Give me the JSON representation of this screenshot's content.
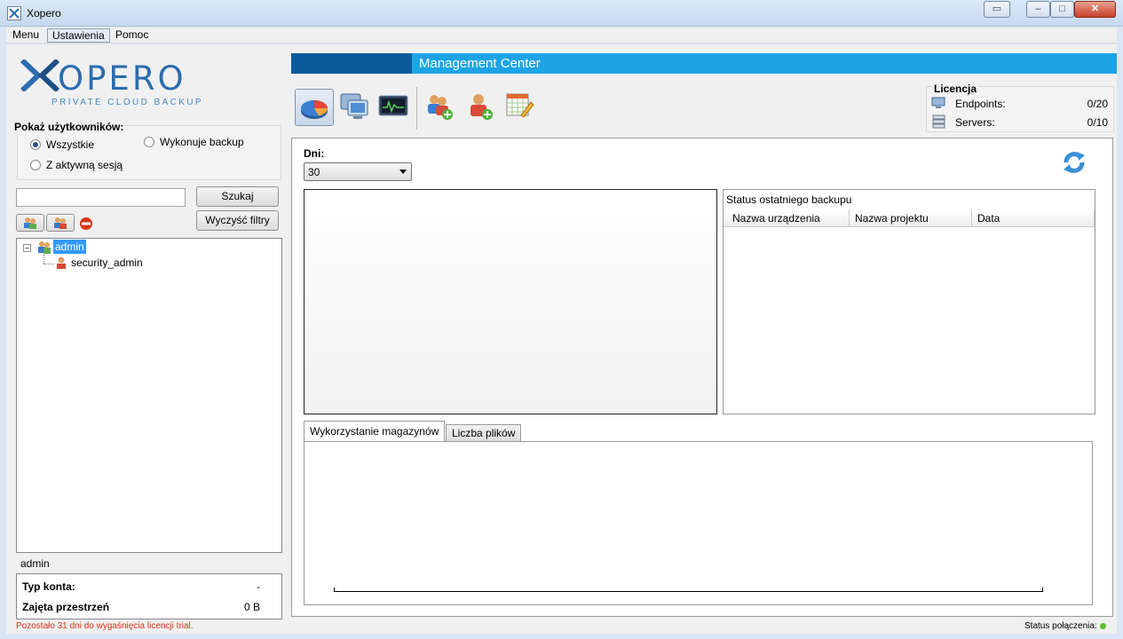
{
  "window": {
    "title": "Xopero"
  },
  "menu": {
    "items": [
      "Menu",
      "Ustawienia",
      "Pomoc"
    ],
    "active": "Ustawienia"
  },
  "logo": {
    "name": "XOPERO",
    "tagline": "PRIVATE CLOUD BACKUP"
  },
  "filters": {
    "title": "Pokaż użytkowników:",
    "options": {
      "all": "Wszystkie",
      "backing_up": "Wykonuje backup",
      "active_session": "Z aktywną sesją"
    },
    "selected": "Wszystkie"
  },
  "search": {
    "value": "",
    "button": "Szukaj",
    "clear_button": "Wyczyść filtry"
  },
  "tree": {
    "root": "admin",
    "child": "security_admin"
  },
  "selected_user": "admin",
  "account_info": {
    "type_label": "Typ konta:",
    "type_value": "-",
    "space_label": "Zajęta przestrzeń",
    "space_value": "0 B"
  },
  "status": {
    "trial": "Pozostało 31 dni do wygaśnięcia licencji trial.",
    "connection_label": "Status połączenia:",
    "connection_color": "#5dbb2b"
  },
  "header": {
    "title": "Management Center"
  },
  "toolbar": [
    "dashboard-chart-icon",
    "computers-icon",
    "monitor-icon",
    "add-group-icon",
    "add-user-icon",
    "schedule-icon"
  ],
  "license": {
    "title": "Licencja",
    "endpoints_label": "Endpoints:",
    "endpoints_value": "0/20",
    "servers_label": "Servers:",
    "servers_value": "0/10"
  },
  "dashboard": {
    "days_label": "Dni:",
    "days_value": "30",
    "status_title": "Status ostatniego backupu",
    "columns": [
      "Nazwa urządzenia",
      "Nazwa projektu",
      "Data"
    ],
    "tabs": [
      "Wykorzystanie magazynów",
      "Liczba plików"
    ],
    "active_tab": "Wykorzystanie magazynów"
  },
  "colors": {
    "brand": "#2b6dae",
    "header_bar": "#1da4e4",
    "header_dark": "#0a5b9c",
    "trial_text": "#d9351c"
  }
}
